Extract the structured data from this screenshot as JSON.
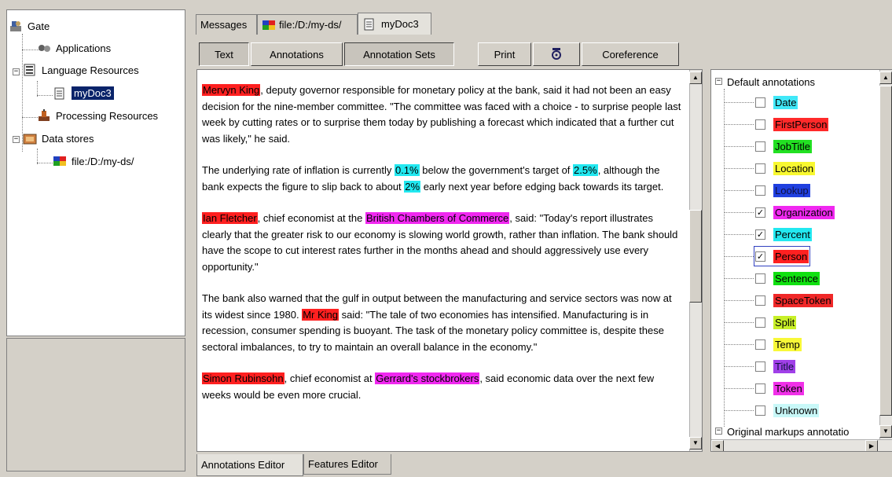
{
  "tree": {
    "root": "Gate",
    "items": [
      {
        "label": "Applications"
      },
      {
        "label": "Language Resources"
      },
      {
        "label": "myDoc3"
      },
      {
        "label": "Processing Resources"
      },
      {
        "label": "Data stores"
      },
      {
        "label": "file:/D:/my-ds/"
      }
    ]
  },
  "tabs": [
    {
      "label": "Messages"
    },
    {
      "label": "file:/D:/my-ds/"
    },
    {
      "label": "myDoc3"
    }
  ],
  "toolbar": {
    "text": "Text",
    "annotations": "Annotations",
    "annotation_sets": "Annotation Sets",
    "print": "Print",
    "coreference": "Coreference"
  },
  "document": {
    "p1": {
      "e1": "Mervyn King",
      "t1": ", deputy governor responsible for monetary policy at the bank, said it had not been an easy decision for the nine-member committee. \"The committee was faced with a choice - to surprise people last week by cutting rates or to surprise them today by publishing a forecast which indicated that a further cut was likely,\" he said."
    },
    "p2": {
      "t1": "The underlying rate of inflation is currently ",
      "e1": "0.1%",
      "t2": " below the government's target of ",
      "e2": "2.5%",
      "t3": ", although the bank expects the figure to slip back to about ",
      "e3": "2%",
      "t4": " early next year before edging back towards its target."
    },
    "p3": {
      "e1": "Ian Fletcher",
      "t1": ", chief economist at the ",
      "e2": "British Chambers of Commerce",
      "t2": ", said: \"Today's report illustrates clearly that the greater risk to our economy is slowing world growth, rather than inflation. The bank should have the scope to cut interest rates further in the months ahead and should aggressively use every opportunity.\""
    },
    "p4": {
      "t1": "The bank also warned that the gulf in output between the manufacturing and service sectors was now at its widest since 1980. ",
      "e1": "Mr King",
      "t2": " said: \"The tale of two economies has intensified. Manufacturing is in recession, consumer spending is buoyant. The task of the monetary policy committee is, despite these sectoral imbalances, to try to maintain an overall balance in the economy.\""
    },
    "p5": {
      "e1": "Simon Rubinsohn",
      "t1": ", chief economist at ",
      "e2": "Gerrard's stockbrokers",
      "t2": ", said economic data over the next few weeks would be even more crucial."
    }
  },
  "annotation_sets": {
    "default_label": "Default annotations",
    "original_label": "Original markups annotatio",
    "types": [
      {
        "label": "Date",
        "color": "#40e8f8",
        "checked": false
      },
      {
        "label": "FirstPerson",
        "color": "#ff2a2a",
        "checked": false
      },
      {
        "label": "JobTitle",
        "color": "#22e022",
        "checked": false
      },
      {
        "label": "Location",
        "color": "#f8f830",
        "checked": false
      },
      {
        "label": "Lookup",
        "color": "#2040e0",
        "checked": false
      },
      {
        "label": "Organization",
        "color": "#f028f0",
        "checked": true
      },
      {
        "label": "Percent",
        "color": "#22e8f0",
        "checked": true
      },
      {
        "label": "Person",
        "color": "#ff2020",
        "checked": true
      },
      {
        "label": "Sentence",
        "color": "#10e010",
        "checked": false
      },
      {
        "label": "SpaceToken",
        "color": "#f02828",
        "checked": false
      },
      {
        "label": "Split",
        "color": "#c8f028",
        "checked": false
      },
      {
        "label": "Temp",
        "color": "#f8f838",
        "checked": false
      },
      {
        "label": "Title",
        "color": "#a040e8",
        "checked": false
      },
      {
        "label": "Token",
        "color": "#f030e8",
        "checked": false
      },
      {
        "label": "Unknown",
        "color": "#c8f8f8",
        "checked": false
      }
    ]
  },
  "bottom_tabs": {
    "annotations_editor": "Annotations Editor",
    "features_editor": "Features Editor"
  }
}
